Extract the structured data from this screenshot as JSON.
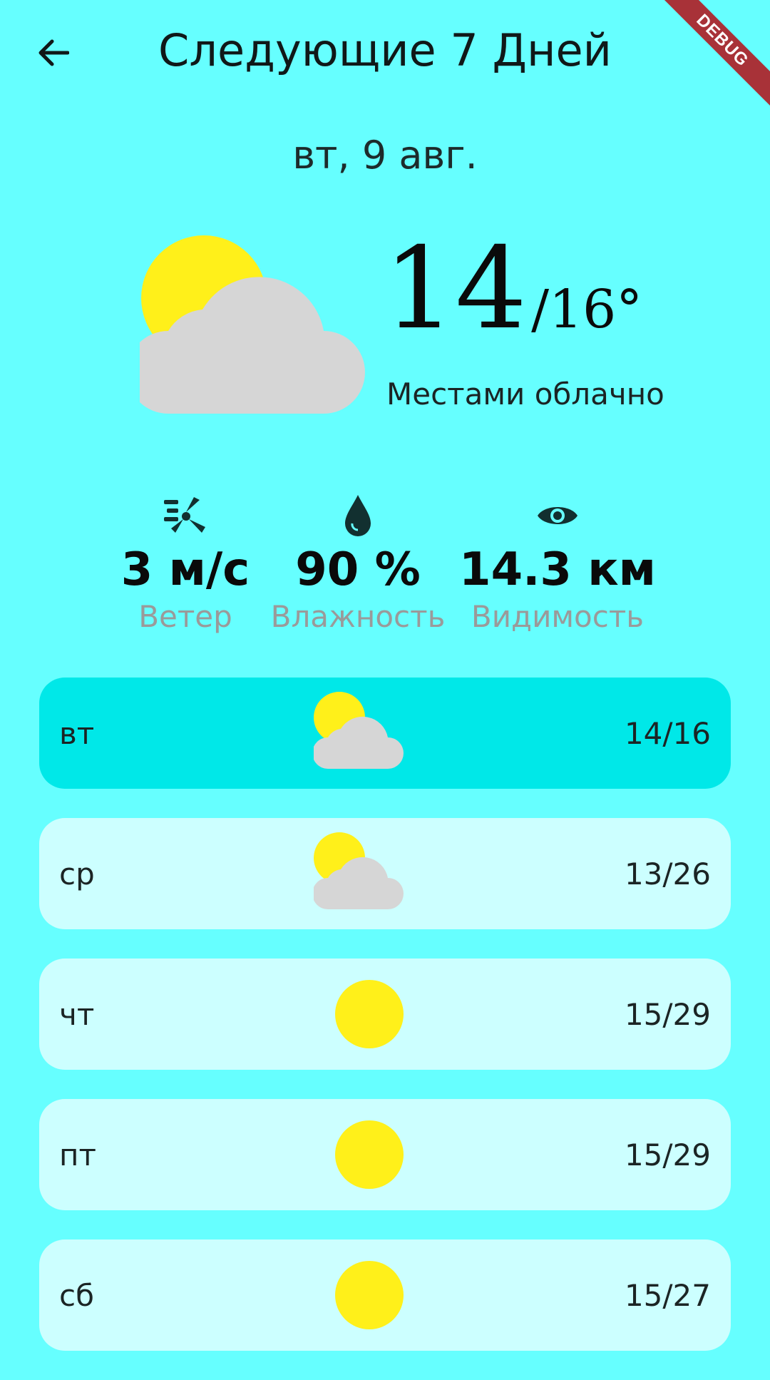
{
  "header": {
    "title": "Следующие 7 Дней",
    "back_icon": "arrow-left-icon"
  },
  "debug_banner": "DEBUG",
  "current": {
    "date": "вт, 9 авг.",
    "temp_main": "14",
    "temp_rest": "/16°",
    "condition": "Местами облачно",
    "icon": "partly-cloudy-icon"
  },
  "stats": [
    {
      "icon": "wind-turbine-icon",
      "value": "3 м/с",
      "label": "Ветер"
    },
    {
      "icon": "water-drop-icon",
      "value": "90 %",
      "label": "Влажность"
    },
    {
      "icon": "eye-icon",
      "value": "14.3 км",
      "label": "Видимость"
    }
  ],
  "days": [
    {
      "name": "вт",
      "range": "14/16",
      "icon": "partly-cloudy-icon",
      "selected": true
    },
    {
      "name": "ср",
      "range": "13/26",
      "icon": "partly-cloudy-icon",
      "selected": false
    },
    {
      "name": "чт",
      "range": "15/29",
      "icon": "sun-icon",
      "selected": false
    },
    {
      "name": "пт",
      "range": "15/29",
      "icon": "sun-icon",
      "selected": false
    },
    {
      "name": "сб",
      "range": "15/27",
      "icon": "sun-icon",
      "selected": false
    }
  ],
  "colors": {
    "background": "#66ffff",
    "card": "#ccffff",
    "card_selected": "#00e8e8",
    "sun": "#fff01a",
    "cloud": "#d6d6d6"
  }
}
